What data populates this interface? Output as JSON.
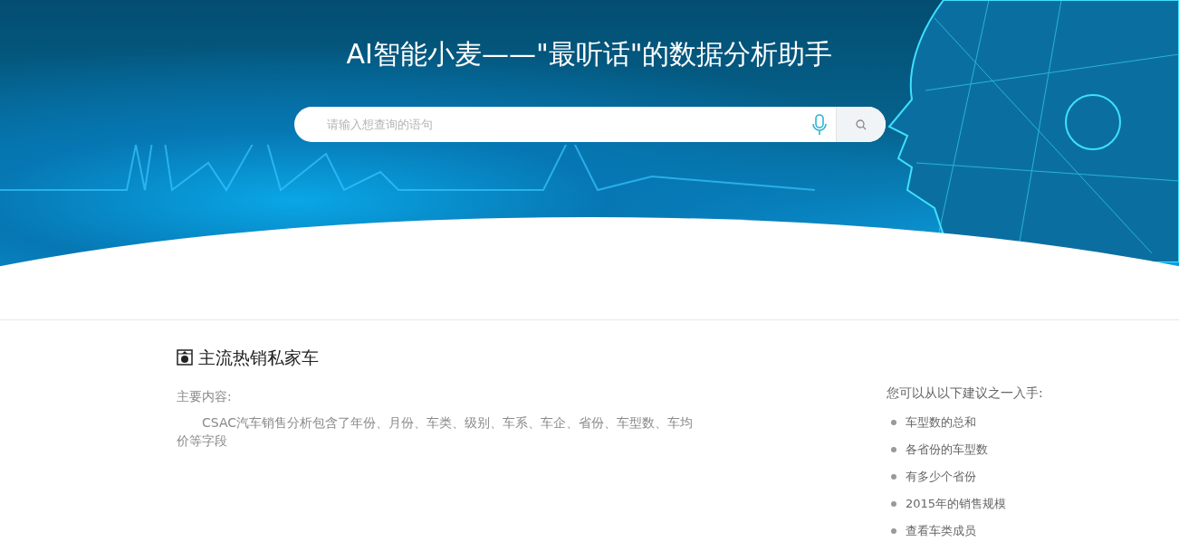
{
  "header": {
    "title": "AI智能小麦——\"最听话\"的数据分析助手",
    "search": {
      "placeholder": "请输入想查询的语句"
    }
  },
  "dataset": {
    "title": "主流热销私家车",
    "content_label": "主要内容:",
    "description": "CSAC汽车销售分析包含了年份、月份、车类、级别、车系、车企、省份、车型数、车均价等字段"
  },
  "suggestions": {
    "heading": "您可以从以下建议之一入手:",
    "items": [
      "车型数的总和",
      "各省份的车型数",
      "有多少个省份",
      "2015年的销售规模",
      "查看车类成员"
    ]
  }
}
